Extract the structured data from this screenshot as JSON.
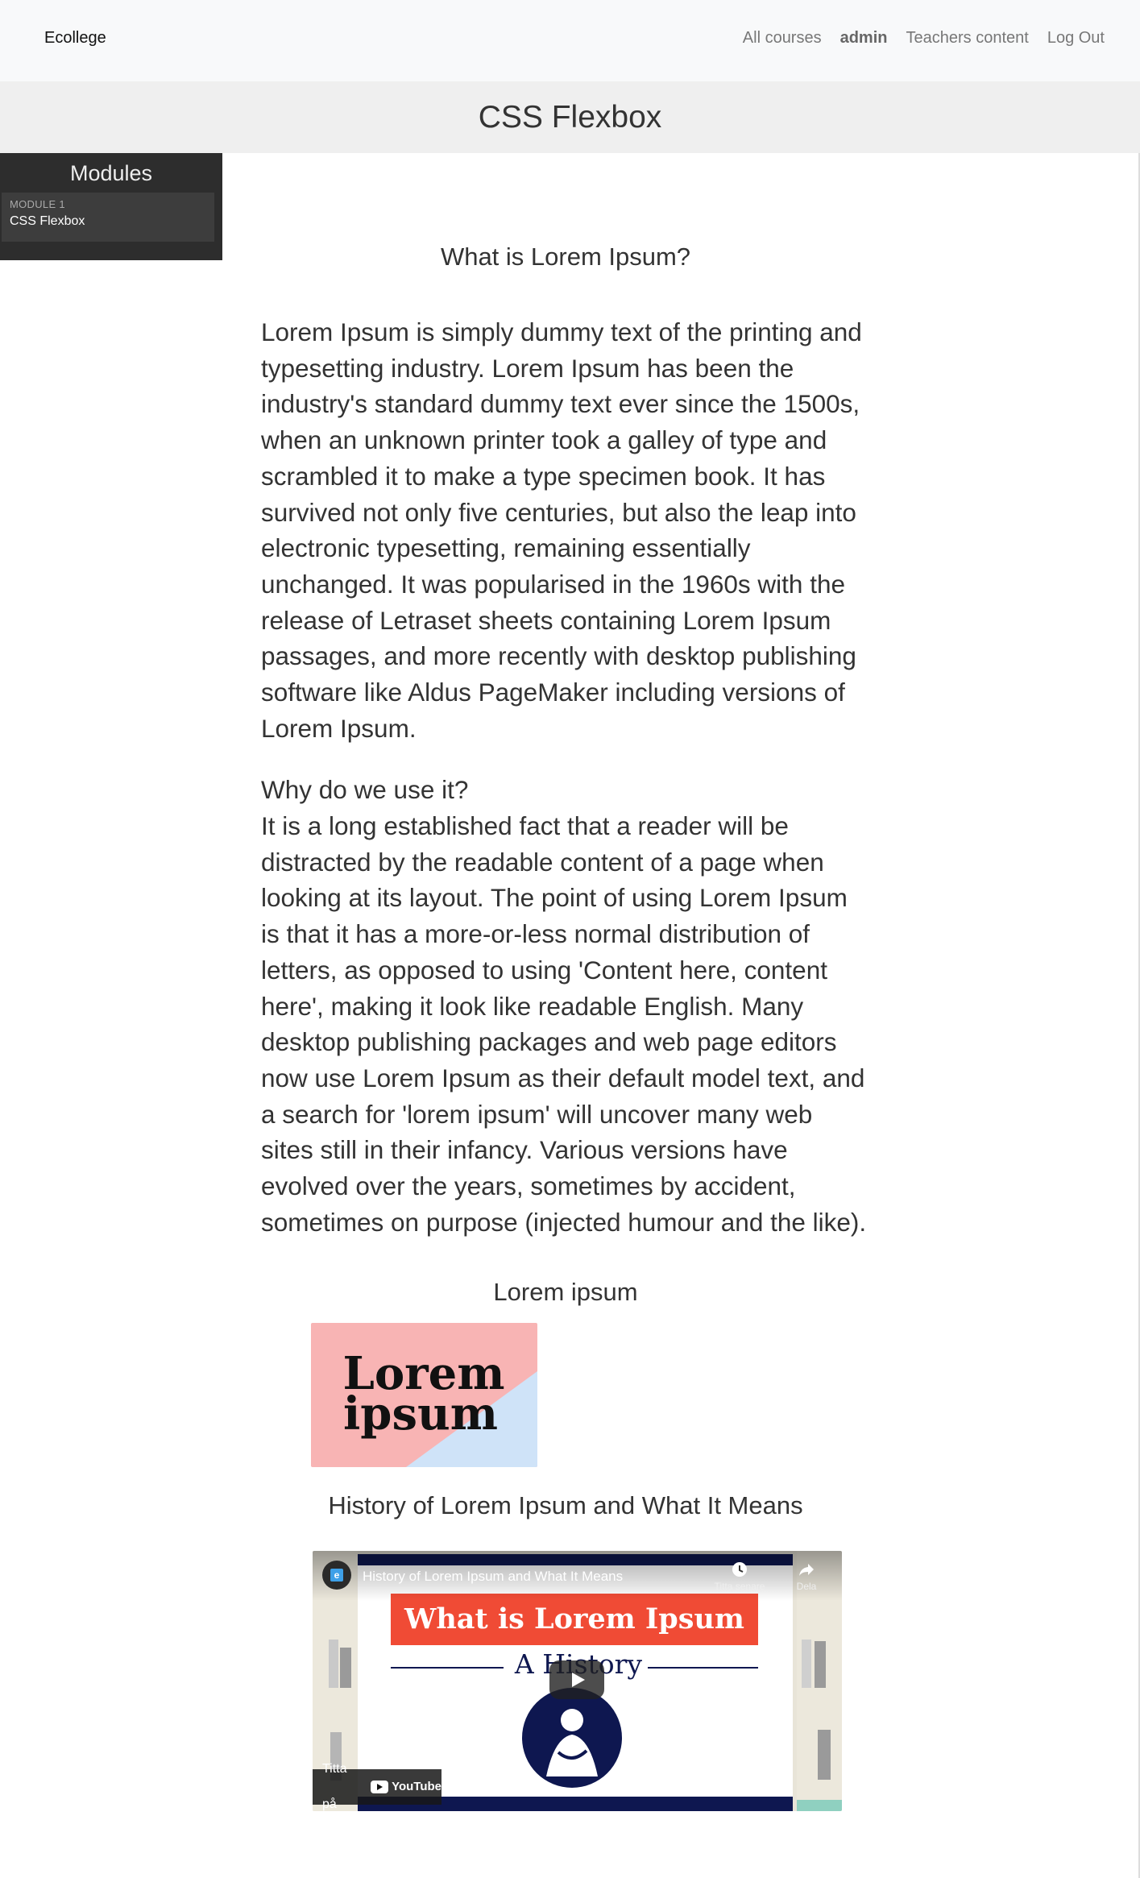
{
  "navbar": {
    "brand": "Ecollege",
    "links": [
      "All courses",
      "admin",
      "Teachers content",
      "Log Out"
    ]
  },
  "page_title": "CSS Flexbox",
  "sidebar": {
    "title": "Modules",
    "module": {
      "label": "MODULE 1",
      "name": "CSS Flexbox"
    }
  },
  "content": {
    "section1_title": "What is Lorem Ipsum?",
    "section1_text": "Lorem Ipsum is simply dummy text of the printing and typesetting industry. Lorem Ipsum has been the industry's standard dummy text ever since the 1500s, when an unknown printer took a galley of type and scrambled it to make a type specimen book. It has survived not only five centuries, but also the leap into electronic typesetting, remaining essentially unchanged. It was popularised in the 1960s with the release of Letraset sheets containing Lorem Ipsum passages, and more recently with desktop publishing software like Aldus PageMaker including versions of Lorem Ipsum.",
    "section2_title": "Why do we use it?",
    "section2_text": "It is a long established fact that a reader will be distracted by the readable content of a page when looking at its layout. The point of using Lorem Ipsum is that it has a more-or-less normal distribution of letters, as opposed to using 'Content here, content here', making it look like readable English. Many desktop publishing packages and web page editors now use Lorem Ipsum as their default model text, and a search for 'lorem ipsum' will uncover many web sites still in their infancy. Various versions have evolved over the years, sometimes by accident, sometimes on purpose (injected humour and the like).",
    "image_title": "Lorem ipsum",
    "image_text_line1": "Lorem",
    "image_text_line2": "ipsum",
    "video_section_title": "History of Lorem Ipsum and What It Means"
  },
  "video": {
    "title": "History of Lorem Ipsum and What It Means",
    "channel_icon_letter": "e",
    "watch_later": "Titta senare",
    "share": "Dela",
    "banner": "What is Lorem Ipsum",
    "subtitle": "A History",
    "watch_on": "Titta på",
    "youtube": "YouTube"
  },
  "colors": {
    "navbar_bg": "#f8f9fa",
    "titlebar_bg": "#efefef",
    "sidebar_bg": "#2d2d2d",
    "image_pink": "#f8b4b4",
    "image_blue": "#cfe3f8",
    "banner_red": "#f04b35",
    "navy": "#0e1750"
  }
}
